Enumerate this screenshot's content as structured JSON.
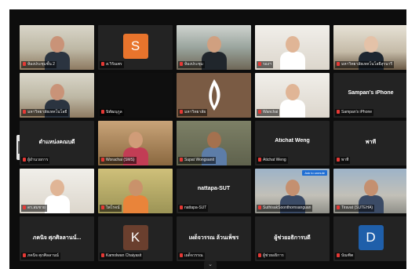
{
  "colors": {
    "active_speaker": "#9ad13a",
    "avatar_s": "#e8742c",
    "avatar_k": "#6a3f2e",
    "avatar_d": "#1f5faa",
    "muted": "#e53935"
  },
  "tiles": [
    {
      "id": "t1",
      "kind": "video",
      "video": "v-office",
      "label": "ห้องประชุมชั้น 2"
    },
    {
      "id": "t2",
      "kind": "avatar",
      "initial": "S",
      "avatar_color": "#e8742c",
      "label": "ส.วิรัณพร"
    },
    {
      "id": "t3",
      "kind": "video",
      "video": "v-office2",
      "label": "ห้องประชุม"
    },
    {
      "id": "t4",
      "kind": "video",
      "video": "v-light",
      "label": "รองฯ"
    },
    {
      "id": "t5",
      "kind": "video",
      "video": "v-room",
      "label": "มหาวิทยาลัยเทคโนโลยีสุรนารี"
    },
    {
      "id": "t6",
      "kind": "video",
      "video": "v-office",
      "label": "มหาวิทยาลัยเทคโนโลยี"
    },
    {
      "id": "t7",
      "kind": "video",
      "video": "v-dark",
      "label": "นิพัฒนุกูล"
    },
    {
      "id": "t8",
      "kind": "logo",
      "video": "v-logo",
      "label": "มหาวิทยาลัย"
    },
    {
      "id": "t9",
      "kind": "video",
      "video": "v-light",
      "label": "Wanchai"
    },
    {
      "id": "t10",
      "kind": "name",
      "name": "Sampan's iPhone",
      "label": "Sampan's iPhone"
    },
    {
      "id": "t11",
      "kind": "name",
      "name": "ตำแหน่งคณบดี",
      "label": "ผู้อำนวยการ"
    },
    {
      "id": "t12",
      "kind": "video",
      "video": "v-brown",
      "label": "Worachai (SMS)"
    },
    {
      "id": "t13",
      "kind": "video",
      "video": "v-shelf",
      "label": "Supat Wongsanit",
      "active": true
    },
    {
      "id": "t14",
      "kind": "name",
      "name": "Atichat Weng",
      "label": "Atichat Weng"
    },
    {
      "id": "t15",
      "kind": "name",
      "name": "พาที",
      "label": "พาที"
    },
    {
      "id": "t16",
      "kind": "video",
      "video": "v-light",
      "label": "ดร.สมชาย"
    },
    {
      "id": "t17",
      "kind": "video",
      "video": "v-yellow",
      "label": "ไพโรจน์"
    },
    {
      "id": "t18",
      "kind": "name",
      "name": "nattapa-SUT",
      "label": "nattapa-SUT"
    },
    {
      "id": "t19",
      "kind": "video",
      "video": "v-street",
      "label": "SuthisakSoonthornsanguan",
      "pill": "Ask to unmute"
    },
    {
      "id": "t20",
      "kind": "video",
      "video": "v-street",
      "label": "Tiravat (SUTEHA)"
    },
    {
      "id": "t21",
      "kind": "name",
      "name": "ภคนิจ ศุภศิลลานน์...",
      "label": "ภคนิจ ศุภศิลลานน์"
    },
    {
      "id": "t22",
      "kind": "avatar",
      "initial": "K",
      "avatar_color": "#6a3f2e",
      "label": "Kamolwan Chaiyasit"
    },
    {
      "id": "t23",
      "kind": "name",
      "name": "เผด็จวรรณ ล้วนเพ็ชร",
      "label": "เผด็จวรรณ"
    },
    {
      "id": "t24",
      "kind": "name",
      "name": "ผู้ช่วยอธิการบดี",
      "label": "ผู้ช่วยอธิการ"
    },
    {
      "id": "t25",
      "kind": "avatar",
      "initial": "D",
      "avatar_color": "#1f5faa",
      "label": "บัณฑิต"
    }
  ],
  "controls": {
    "expand_chevron": "⌄"
  }
}
